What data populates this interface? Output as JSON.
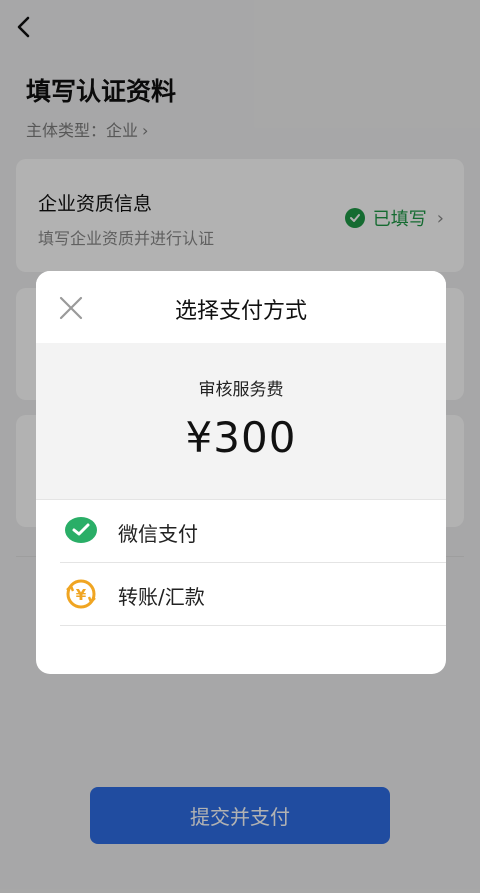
{
  "page": {
    "title": "填写认证资料",
    "subject_type_label": "主体类型：企业",
    "subject_type_chevron": "›"
  },
  "card1": {
    "title": "企业资质信息",
    "subtitle": "填写企业资质并进行认证",
    "status": "已填写",
    "status_color": "#1f9a47"
  },
  "submit_label": "提交并支付",
  "modal": {
    "title": "选择支付方式",
    "fee_label": "审核服务费",
    "fee_amount": "¥300",
    "options": [
      {
        "label": "微信支付",
        "icon": "wechat-icon"
      },
      {
        "label": "转账/汇款",
        "icon": "transfer-icon"
      }
    ]
  },
  "colors": {
    "accent": "#2e6ee6",
    "wechat_green": "#2aae67",
    "transfer_orange": "#f0a522"
  }
}
